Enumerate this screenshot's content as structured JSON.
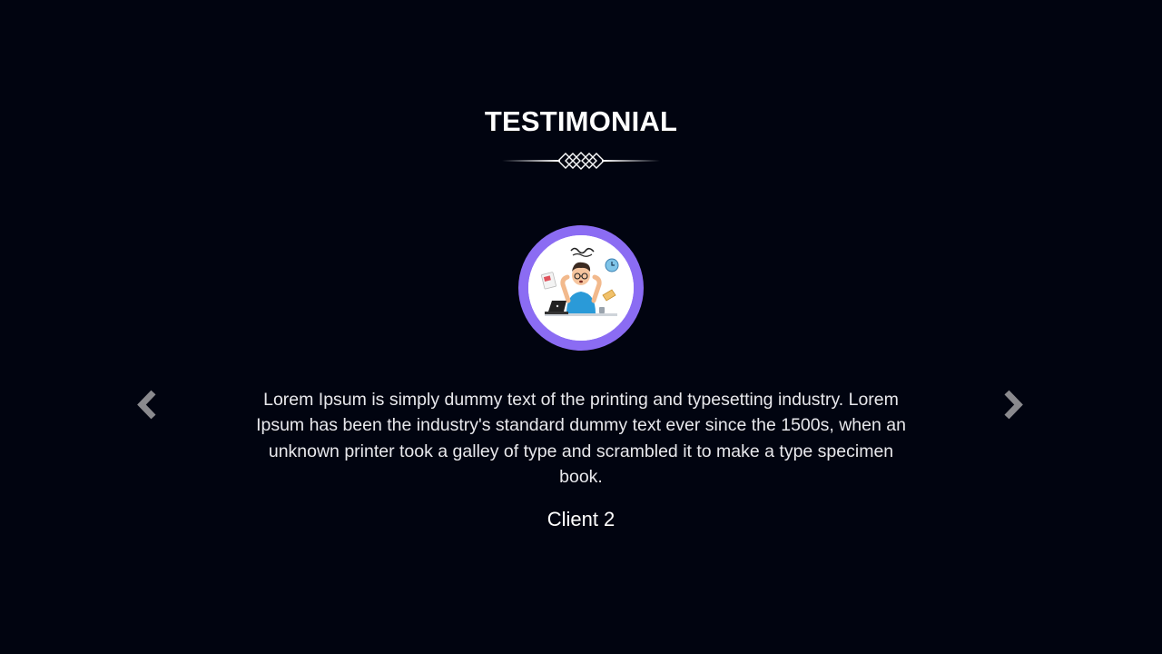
{
  "testimonial": {
    "heading": "TESTIMONIAL",
    "current": {
      "quote": "Lorem Ipsum is simply dummy text of the printing and typesetting industry. Lorem Ipsum has been the industry's standard dummy text ever since the 1500s, when an unknown printer took a galley of type and scrambled it to make a type specimen book.",
      "client_name": "Client 2",
      "avatar_icon": "stressed-worker-illustration"
    },
    "controls": {
      "prev_icon": "chevron-left-icon",
      "next_icon": "chevron-right-icon"
    }
  },
  "colors": {
    "background": "#010410",
    "avatar_ring": "#8b6cf3",
    "arrow": "#8a8a8e",
    "text": "#ffffff"
  }
}
